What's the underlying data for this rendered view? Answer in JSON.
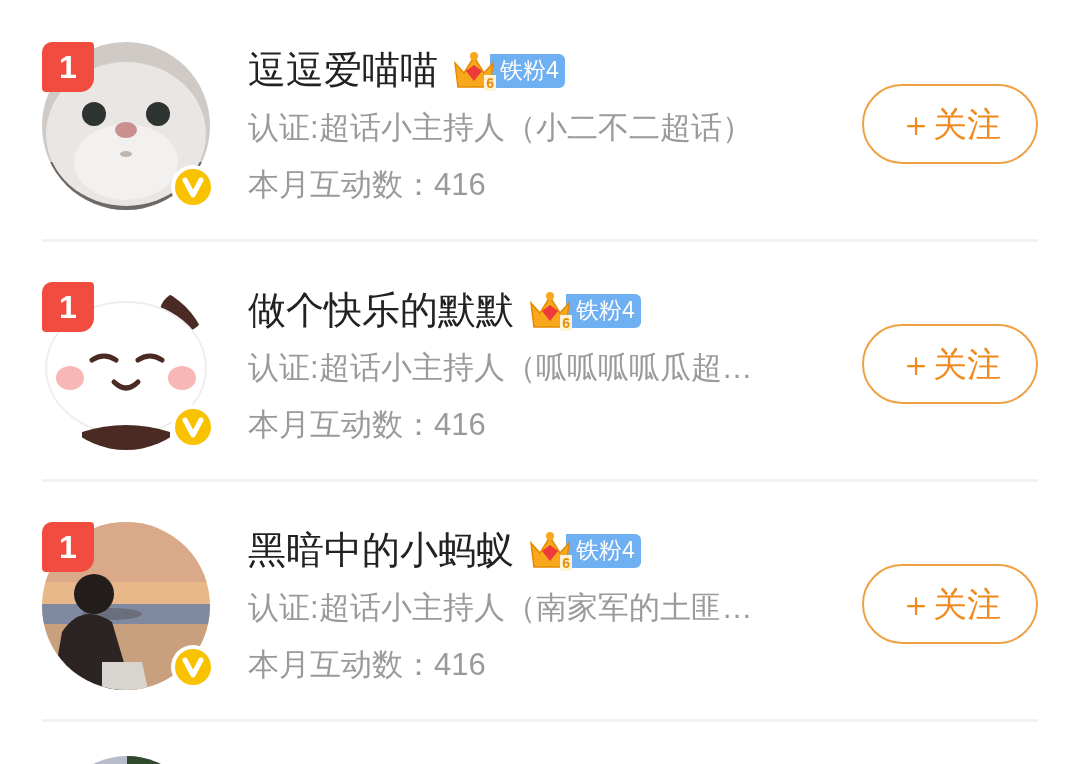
{
  "users": [
    {
      "rank": "1",
      "name": "逗逗爱喵喵",
      "crown_level": "6",
      "fan_badge": "铁粉4",
      "certification": "认证:超话小主持人（小二不二超话）",
      "interactions": "本月互动数：416",
      "verified": true,
      "follow_button": "＋关注"
    },
    {
      "rank": "1",
      "name": "做个快乐的默默",
      "crown_level": "6",
      "fan_badge": "铁粉4",
      "certification": "认证:超话小主持人（呱呱呱呱瓜超…",
      "interactions": "本月互动数：416",
      "verified": true,
      "follow_button": "＋关注"
    },
    {
      "rank": "1",
      "name": "黑暗中的小蚂蚁",
      "crown_level": "6",
      "fan_badge": "铁粉4",
      "certification": "认证:超话小主持人（南家军的土匪…",
      "interactions": "本月互动数：416",
      "verified": true,
      "follow_button": "＋关注"
    }
  ]
}
